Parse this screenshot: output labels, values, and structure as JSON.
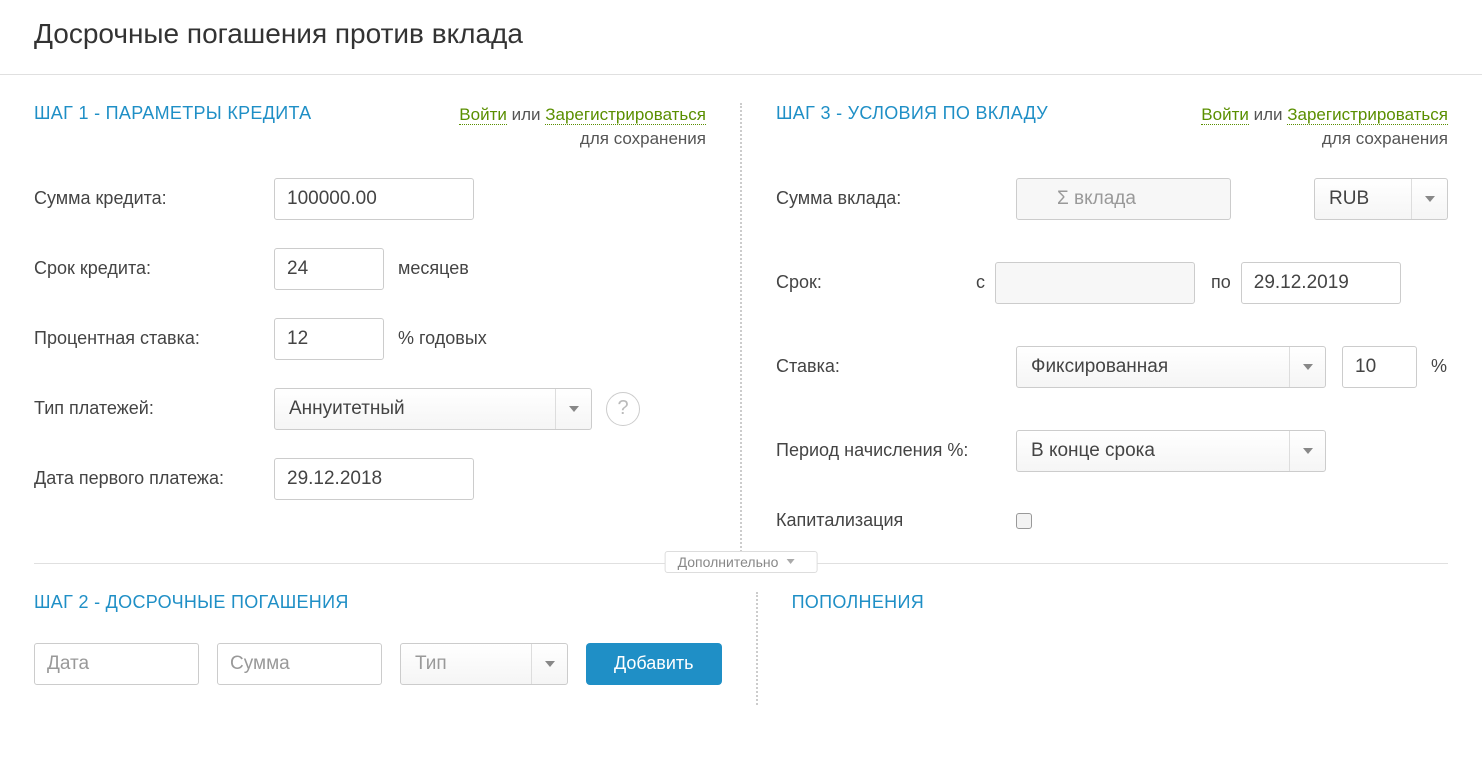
{
  "title": "Досрочные погашения против вклада",
  "login_prompt": {
    "login": "Войти",
    "or": "или",
    "register": "Зарегистрироваться",
    "for_save": "для сохранения"
  },
  "extra_toggle": "Дополнительно",
  "step1": {
    "title": "ШАГ 1 - ПАРАМЕТРЫ КРЕДИТА",
    "amount_label": "Сумма кредита:",
    "amount_value": "100000.00",
    "term_label": "Срок кредита:",
    "term_value": "24",
    "term_unit": "месяцев",
    "rate_label": "Процентная ставка:",
    "rate_value": "12",
    "rate_unit": "% годовых",
    "payment_type_label": "Тип платежей:",
    "payment_type_value": "Аннуитетный",
    "first_payment_label": "Дата первого платежа:",
    "first_payment_value": "29.12.2018"
  },
  "step2": {
    "title": "ШАГ 2 - ДОСРОЧНЫЕ ПОГАШЕНИЯ",
    "date_placeholder": "Дата",
    "sum_placeholder": "Сумма",
    "type_placeholder": "Тип",
    "add_button": "Добавить"
  },
  "step3": {
    "title": "ШАГ 3 - УСЛОВИЯ ПО ВКЛАДУ",
    "deposit_amount_label": "Сумма вклада:",
    "deposit_amount_placeholder": "Σ вклада",
    "currency_value": "RUB",
    "term_label": "Срок:",
    "from_label": "с",
    "to_label": "по",
    "to_value": "29.12.2019",
    "rate_label": "Ставка:",
    "rate_type_value": "Фиксированная",
    "rate_value": "10",
    "rate_unit": "%",
    "interest_period_label": "Период начисления %:",
    "interest_period_value": "В конце срока",
    "capitalization_label": "Капитализация"
  },
  "replenishments": {
    "title": "ПОПОЛНЕНИЯ"
  }
}
